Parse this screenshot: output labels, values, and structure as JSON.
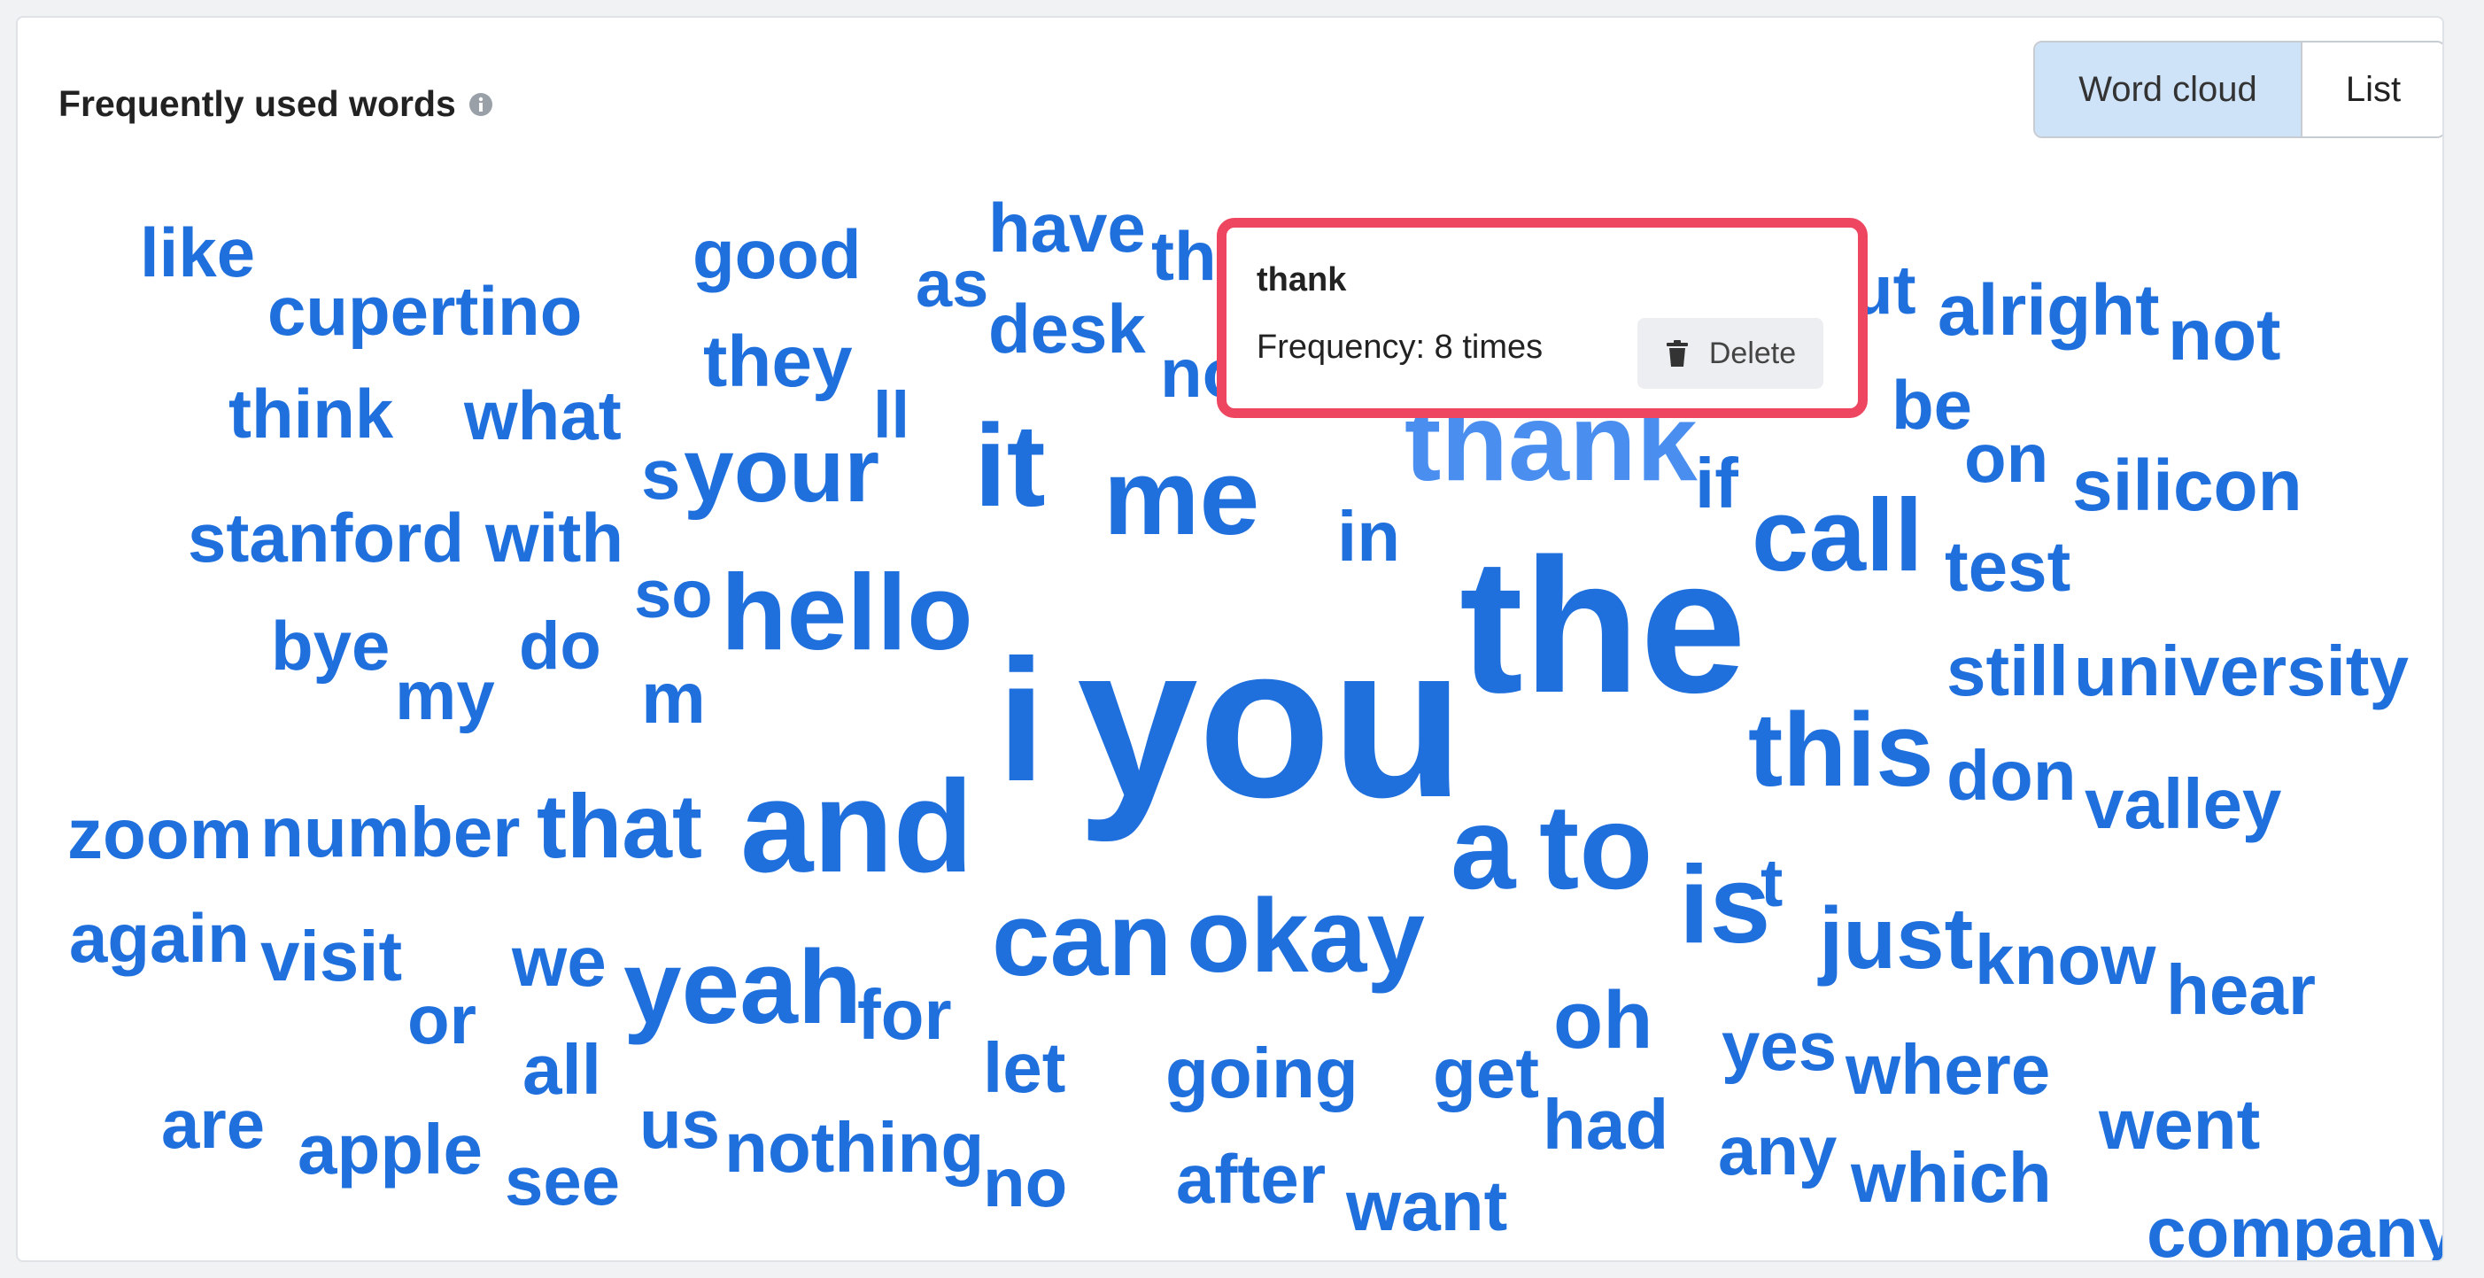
{
  "header": {
    "title": "Frequently used words",
    "info_icon": "info-icon"
  },
  "view_toggle": {
    "options": [
      "Word cloud",
      "List"
    ],
    "selected": "Word cloud"
  },
  "colors": {
    "word": "#1f6fdd",
    "word_hover": "#4a8ff0",
    "highlight_border": "#ee4660",
    "toggle_active": "#cfe3f8"
  },
  "words": [
    "like",
    "cupertino",
    "good",
    "as",
    "have",
    "th",
    "desk",
    "no",
    "alright",
    "not",
    "they",
    "think",
    "what",
    "ll",
    "s",
    "your",
    "it",
    "me",
    "ut",
    "be",
    "thank",
    "if",
    "on",
    "silicon",
    "stanford",
    "with",
    "in",
    "call",
    "test",
    "so",
    "hello",
    "the",
    "bye",
    "do",
    "my",
    "m",
    "i",
    "you",
    "still",
    "university",
    "this",
    "don",
    "valley",
    "zoom",
    "number",
    "that",
    "and",
    "a",
    "to",
    "is",
    "t",
    "just",
    "again",
    "visit",
    "can",
    "okay",
    "know",
    "hear",
    "or",
    "we",
    "yeah",
    "for",
    "oh",
    "all",
    "let",
    "going",
    "get",
    "yes",
    "where",
    "are",
    "apple",
    "us",
    "nothing",
    "had",
    "any",
    "went",
    "see",
    "no",
    "after",
    "want",
    "which",
    "company"
  ],
  "tooltip": {
    "word": "thank",
    "frequency": "Frequency: 8 times",
    "delete_label": "Delete",
    "delete_icon": "trash-icon"
  }
}
